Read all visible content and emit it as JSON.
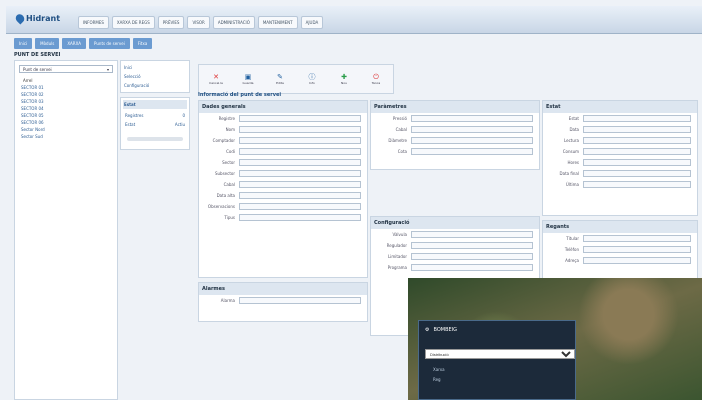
{
  "app": {
    "logo": "Hidrant"
  },
  "menu": [
    "INFORMES",
    "XARXA DE REGS",
    "PRÈVIES",
    "VISOR",
    "ADMINISTRACIÓ",
    "MANTENIMENT",
    "AJUDA"
  ],
  "breadcrumb": [
    "Inici",
    "Mòduls",
    "XARXA",
    "Punts de servei",
    "Fitxa"
  ],
  "page_title": "PUNT DE SERVEI",
  "left": {
    "select": "Punt de servei",
    "tree": [
      "Arrel",
      "SECTOR 01",
      "SECTOR 02",
      "SECTOR 03",
      "SECTOR 04",
      "SECTOR 05",
      "SECTOR 06",
      "Sector Nord",
      "Sector Sud"
    ]
  },
  "side": {
    "links": [
      "Inici",
      "Selecció",
      "Configuració"
    ],
    "block_title": "Estat",
    "kv": [
      [
        "Registres",
        "0"
      ],
      [
        "Estat",
        "Actiu"
      ]
    ]
  },
  "toolbar": [
    "Cancel·la",
    "Guarda",
    "Edita",
    "Info",
    "Nou",
    "Tanca"
  ],
  "fitxa_title": "Informació del punt de servei",
  "panels": {
    "dades": {
      "title": "Dades generals",
      "rows": [
        "Registre",
        "Nom",
        "Comptador",
        "Codi",
        "Sector",
        "Subsector",
        "Cabal",
        "Data alta",
        "Observacions",
        "Tipus"
      ]
    },
    "parametres": {
      "title": "Paràmetres",
      "rows": [
        "Pressió",
        "Cabal",
        "Diàmetre",
        "Cota"
      ]
    },
    "estat": {
      "title": "Estat",
      "rows": [
        "Estat",
        "Data",
        "Lectura",
        "Consum",
        "Hores",
        "Data final",
        "Última"
      ]
    },
    "config": {
      "title": "Configuració",
      "rows": [
        "Vàlvula",
        "Regulador",
        "Limitador",
        "Programa"
      ]
    },
    "regants": {
      "title": "Regants",
      "rows": [
        "Titular",
        "Telèfon",
        "Adreça"
      ]
    },
    "alarmes": {
      "title": "Alarmes",
      "rows": [
        "Alarma"
      ]
    }
  },
  "overlay": {
    "title": "BOMBEIG",
    "select": "Distribució",
    "items": [
      "Xarxa",
      "Reg"
    ]
  }
}
